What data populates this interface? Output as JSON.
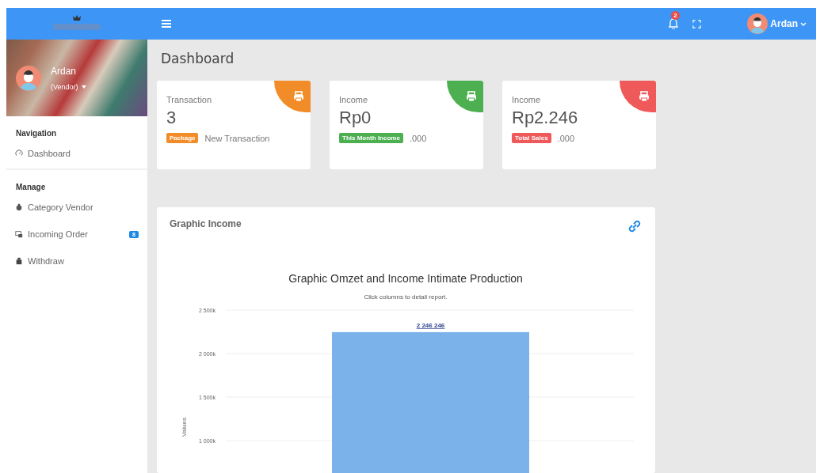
{
  "topbar": {
    "notification_count": "2",
    "user_name": "Ardan"
  },
  "sidebar": {
    "profile": {
      "name": "Ardan",
      "role": "(Vendor)"
    },
    "sections": [
      {
        "heading": "Navigation",
        "items": [
          {
            "label": "Dashboard"
          }
        ]
      },
      {
        "heading": "Manage",
        "items": [
          {
            "label": "Category Vendor"
          },
          {
            "label": "Incoming Order",
            "badge": "8"
          },
          {
            "label": "Withdraw"
          }
        ]
      }
    ]
  },
  "page_title": "Dashboard",
  "cards": [
    {
      "label": "Transaction",
      "value": "3",
      "tag": "Package",
      "note": "New Transaction",
      "color": "#f28c28"
    },
    {
      "label": "Income",
      "value": "Rp0",
      "tag": "This Month Income",
      "note": ".000",
      "color": "#4caf50"
    },
    {
      "label": "Income",
      "value": "Rp2.246",
      "tag": "Total Sales",
      "note": ".000",
      "color": "#f0595a"
    }
  ],
  "chart_panel": {
    "title": "Graphic Income",
    "subtitle": "Click columns to detail report.",
    "chart_data": {
      "type": "bar",
      "title": "Graphic Omzet and Income Intimate Production",
      "ylabel": "Values",
      "ylim": [
        625000,
        2500000
      ],
      "grid": true,
      "values": [
        2246246
      ],
      "value_labels": [
        "2 246 246"
      ],
      "yticks": [
        {
          "value": 1000000,
          "label": "1 000k"
        },
        {
          "value": 1500000,
          "label": "1 500k"
        },
        {
          "value": 2000000,
          "label": "2 000k"
        },
        {
          "value": 2500000,
          "label": "2 500k"
        }
      ]
    }
  }
}
